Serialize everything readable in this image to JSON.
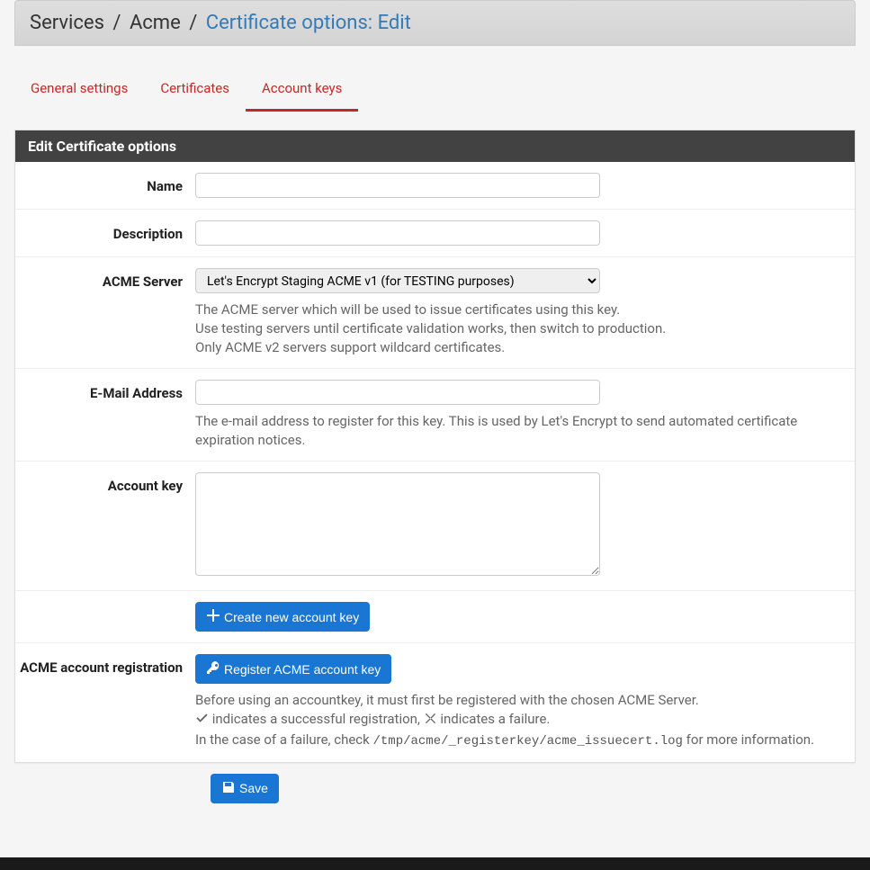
{
  "breadcrumb": {
    "item1": "Services",
    "item2": "Acme",
    "current": "Certificate options: Edit"
  },
  "tabs": {
    "general": "General settings",
    "certificates": "Certificates",
    "account_keys": "Account keys"
  },
  "panel_title": "Edit Certificate options",
  "form": {
    "name_label": "Name",
    "desc_label": "Description",
    "server_label": "ACME Server",
    "server_value": "Let's Encrypt Staging ACME v1 (for TESTING purposes)",
    "server_help1": "The ACME server which will be used to issue certificates using this key.",
    "server_help2": "Use testing servers until certificate validation works, then switch to production.",
    "server_help3": "Only ACME v2 servers support wildcard certificates.",
    "email_label": "E-Mail Address",
    "email_help": "The e-mail address to register for this key. This is used by Let's Encrypt to send automated certificate expiration notices.",
    "key_label": "Account key",
    "create_key_btn": "Create new account key",
    "reg_label": "ACME account registration",
    "register_btn": "Register ACME account key",
    "reg_help1": "Before using an accountkey, it must first be registered with the chosen ACME Server.",
    "reg_help2a": " indicates a successful registration, ",
    "reg_help2b": " indicates a failure.",
    "reg_help3a": "In the case of a failure, check ",
    "reg_help3_code": "/tmp/acme/_registerkey/acme_issuecert.log",
    "reg_help3b": " for more information.",
    "save_btn": "Save"
  }
}
